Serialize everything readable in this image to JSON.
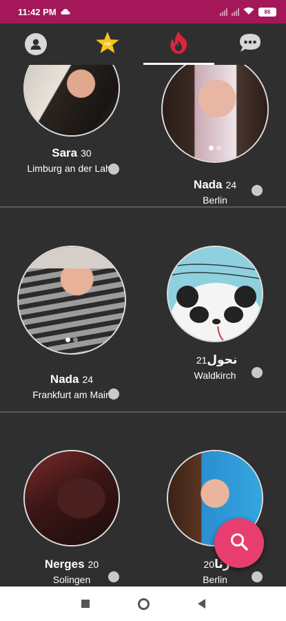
{
  "status_bar": {
    "time": "11:42 PM",
    "battery": "86"
  },
  "tabs": [
    {
      "name": "profile",
      "icon": "profile-icon"
    },
    {
      "name": "favorites",
      "icon": "star-icon"
    },
    {
      "name": "hot",
      "icon": "flame-icon",
      "active": true
    },
    {
      "name": "messages",
      "icon": "chat-icon"
    }
  ],
  "profiles": [
    {
      "name": "Sara",
      "age": "30",
      "city": "Limburg an der Lahn"
    },
    {
      "name": "Nada",
      "age": "24",
      "city": "Berlin"
    },
    {
      "name": "Nada",
      "age": "24",
      "city": "Frankfurt am Main"
    },
    {
      "name": "نحول",
      "age": "21",
      "city": "Waldkirch"
    },
    {
      "name": "Nerges",
      "age": "20",
      "city": "Solingen"
    },
    {
      "name": "رنا",
      "age": "20",
      "city": "Berlin"
    }
  ],
  "colors": {
    "accent": "#a4185a",
    "fab": "#e83d6f",
    "background": "#2f2f2f"
  }
}
